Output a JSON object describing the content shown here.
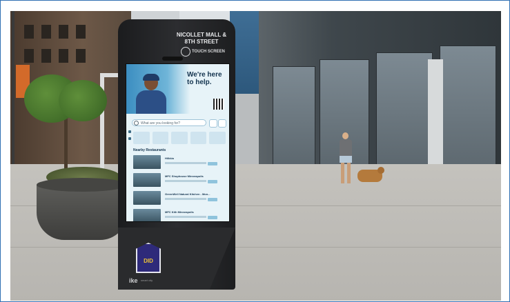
{
  "kiosk": {
    "location_title": "NICOLLET MALL & 8TH STREET",
    "touch_label": "TOUCH SCREEN",
    "logo_text": "DID",
    "brand": "ike",
    "brand_small": "smart city"
  },
  "screen": {
    "hero_title": "We're here to help.",
    "search_placeholder": "What are you looking for?",
    "section_title": "Nearby Restaurants",
    "restaurants": [
      {
        "name": "Hilkkia"
      },
      {
        "name": "MFC Shophouse Minneapolis"
      },
      {
        "name": "GreenWell Natural Kitchen - Mon..."
      },
      {
        "name": "MFC Kith Minneapolis"
      }
    ]
  },
  "colors": {
    "kiosk_body": "#2c2d30",
    "screen_bg": "#e7f3f8",
    "logo_purple": "#2e2a7a",
    "logo_yellow": "#f2c636",
    "frame_border": "#2f6fb3"
  }
}
